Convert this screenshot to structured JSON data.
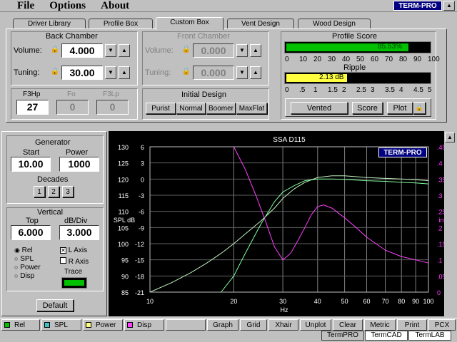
{
  "menu": {
    "file": "File",
    "options": "Options",
    "about": "About"
  },
  "brand": "TERM-PRO",
  "tabs": [
    "Driver Library",
    "Profile Box",
    "Custom Box",
    "Vent Design",
    "Wood Design"
  ],
  "back_chamber": {
    "title": "Back Chamber",
    "volume_label": "Volume:",
    "volume": "4.000",
    "tuning_label": "Tuning:",
    "tuning": "30.00"
  },
  "front_chamber": {
    "title": "Front Chamber",
    "volume_label": "Volume:",
    "volume": "0.000",
    "tuning_label": "Tuning:",
    "tuning": "0.000"
  },
  "freqs": {
    "f3hp_label": "F3Hp",
    "f3hp": "27",
    "fo_label": "Fo",
    "fo": "0",
    "f3lp_label": "F3Lp",
    "f3lp": "0"
  },
  "initial_design": {
    "title": "Initial Design",
    "buttons": [
      "Purist",
      "Normal",
      "Boomer",
      "MaxFlat"
    ]
  },
  "profile_score": {
    "title": "Profile Score",
    "value_text": "85.53%",
    "fill_percent": 85.53,
    "scale": [
      "0",
      "10",
      "20",
      "30",
      "40",
      "50",
      "60",
      "70",
      "80",
      "90",
      "100"
    ]
  },
  "ripple": {
    "title": "Ripple",
    "value_text": "2.13 dB",
    "fill_fraction": 0.426,
    "scale": [
      "0",
      ".5",
      "1",
      "1.5",
      "2",
      "2.5",
      "3",
      "3.5",
      "4",
      "4.5",
      "5"
    ]
  },
  "actions": {
    "vented": "Vented",
    "score": "Score",
    "plot": "Plot"
  },
  "generator": {
    "title": "Generator",
    "start_label": "Start",
    "start": "10.00",
    "power_label": "Power",
    "power": "1000",
    "decades_label": "Decades",
    "decades": [
      "1",
      "2",
      "3"
    ]
  },
  "vertical": {
    "title": "Vertical",
    "top_label": "Top",
    "top": "6.000",
    "dbdiv_label": "dB/Div",
    "dbdiv": "3.000"
  },
  "radios": [
    "Rel",
    "SPL",
    "Power",
    "Disp"
  ],
  "checks": {
    "laxis": "L Axis",
    "raxis": "R Axis"
  },
  "trace_label": "Trace",
  "default_btn": "Default",
  "chart_data": {
    "type": "line",
    "title": "SSA D115",
    "xlabel": "Hz",
    "ylabel_left": "SPL  dB",
    "ylabel_right": "in",
    "x_ticks": [
      "10",
      "20",
      "30",
      "40",
      "50",
      "60",
      "70",
      "80",
      "90",
      "100"
    ],
    "y_spl_ticks": [
      "130",
      "125",
      "120",
      "115",
      "110",
      "105",
      "100",
      "95",
      "90",
      "85"
    ],
    "y_rel_ticks": [
      "6",
      "3",
      "0",
      "-3",
      "-6",
      "-9",
      "-12",
      "-15",
      "-18",
      "-21"
    ],
    "y_right_ticks": [
      ".45",
      ".4",
      ".35",
      ".3",
      ".25",
      ".2",
      ".15",
      ".1",
      ".05",
      "0"
    ],
    "series": [
      {
        "color": "#c0f0c0",
        "x": [
          10,
          12,
          14,
          16,
          18,
          20,
          22,
          25,
          28,
          30,
          33,
          36,
          40,
          45,
          50,
          60,
          70,
          80,
          90,
          100
        ],
        "y": [
          85,
          88,
          91,
          94,
          97,
          100,
          103,
          107,
          111,
          114,
          117,
          119,
          120.5,
          121,
          121,
          120.5,
          120.2,
          120,
          119.8,
          119.5
        ]
      },
      {
        "color": "#80ffa0",
        "x": [
          18,
          20,
          22,
          25,
          28,
          30,
          33,
          36,
          40,
          45,
          50,
          60,
          70,
          80,
          90,
          100
        ],
        "y": [
          85,
          90,
          97,
          106,
          113,
          116,
          118,
          119.5,
          120,
          120,
          119.9,
          119.5,
          119.3,
          119,
          118.8,
          118.5
        ]
      },
      {
        "color": "#ff40ff",
        "x": [
          20,
          22,
          24,
          26,
          28,
          30,
          32,
          34,
          36,
          38,
          40,
          42,
          45,
          50,
          55,
          60,
          70,
          80,
          90,
          100
        ],
        "y": [
          0.45,
          0.38,
          0.3,
          0.22,
          0.14,
          0.1,
          0.12,
          0.16,
          0.2,
          0.24,
          0.265,
          0.27,
          0.26,
          0.23,
          0.2,
          0.17,
          0.13,
          0.11,
          0.1,
          0.09
        ]
      }
    ]
  },
  "bottom": {
    "legend": [
      {
        "label": "Rel",
        "color": "#00c000"
      },
      {
        "label": "SPL",
        "color": "#40c0c0"
      },
      {
        "label": "Power",
        "color": "#ffff80"
      },
      {
        "label": "Disp",
        "color": "#ff40ff"
      }
    ],
    "buttons": [
      "Graph",
      "Grid",
      "Xhair",
      "Unplot",
      "Clear",
      "Metric",
      "Print",
      "PCX"
    ],
    "apps": [
      "TermPRO",
      "TermCAD",
      "TermLAB"
    ]
  }
}
